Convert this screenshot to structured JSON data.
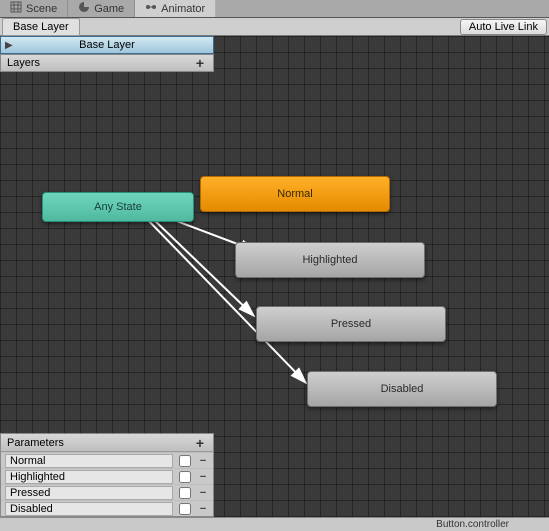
{
  "tabs": {
    "scene": "Scene",
    "game": "Game",
    "animator": "Animator"
  },
  "sub": {
    "base_layer_tab": "Base Layer",
    "auto_live": "Auto Live Link"
  },
  "layer_bar": "Base Layer",
  "layers_header": "Layers",
  "nodes": {
    "any_state": "Any State",
    "normal": "Normal",
    "highlighted": "Highlighted",
    "pressed": "Pressed",
    "disabled": "Disabled"
  },
  "params": {
    "header": "Parameters",
    "items": [
      {
        "name": "Normal"
      },
      {
        "name": "Highlighted"
      },
      {
        "name": "Pressed"
      },
      {
        "name": "Disabled"
      }
    ]
  },
  "status": "Button.controller"
}
